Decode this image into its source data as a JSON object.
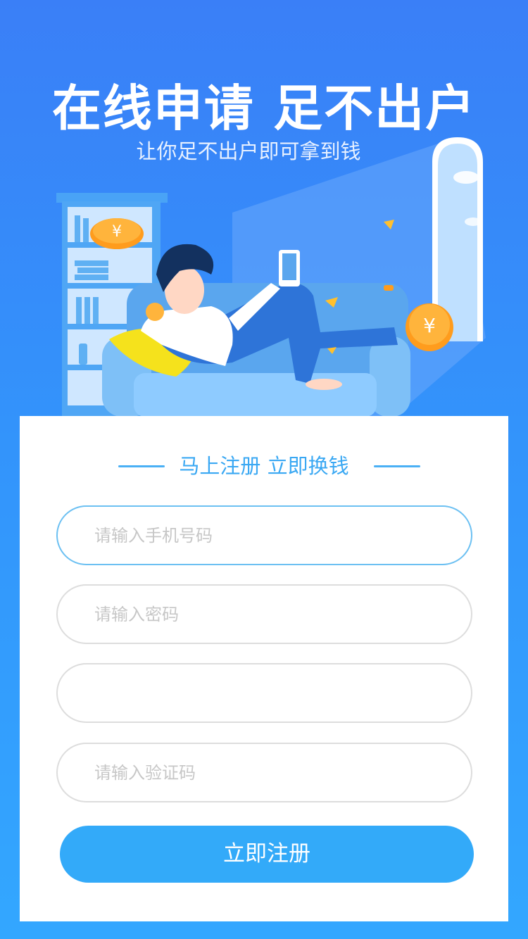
{
  "hero": {
    "title": "在线申请 足不出户",
    "subtitle": "让你足不出户即可拿到钱"
  },
  "form": {
    "heading": "马上注册 立即换钱",
    "phone_placeholder": "请输入手机号码",
    "password_placeholder": "请输入密码",
    "blank_field_placeholder": "",
    "code_placeholder": "请输入验证码",
    "submit_label": "立即注册"
  },
  "colors": {
    "background_top": "#3a7ff7",
    "background_bottom": "#33a7ff",
    "accent": "#33aaf9",
    "heading": "#3aa8f3"
  }
}
